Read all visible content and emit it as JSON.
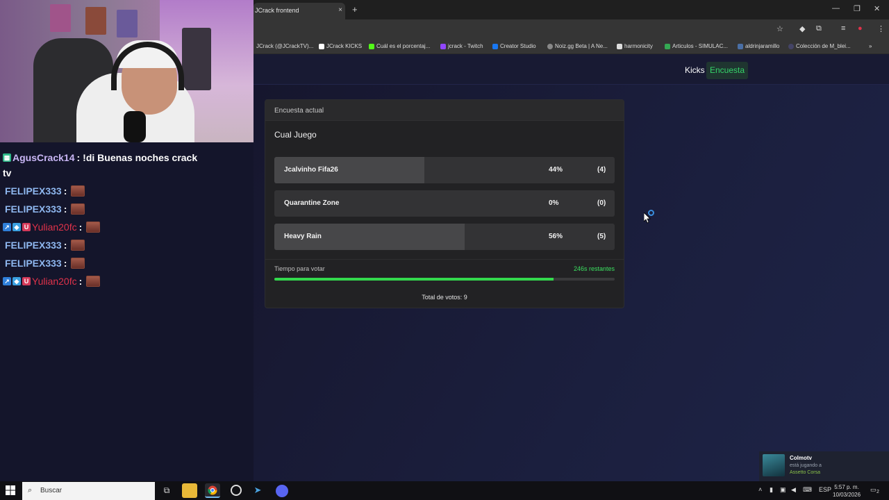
{
  "browser": {
    "tab_title": "JCrack frontend",
    "tab_close": "×",
    "new_tab": "+",
    "window_controls": {
      "minimize": "—",
      "restore": "❐",
      "close": "✕"
    },
    "bookmarks": [
      {
        "label": "JCrack (@JCrackTV)...",
        "color": "#333333"
      },
      {
        "label": "JCrack KICKS",
        "color": "#ffffff"
      },
      {
        "label": "Cuál es el porcentaj...",
        "color": "#53fc18"
      },
      {
        "label": "jcrack - Twitch",
        "color": "#9146ff"
      },
      {
        "label": "Creator Studio",
        "color": "#1877f2"
      },
      {
        "label": "Noiz.gg Beta | A Ne...",
        "color": "#888888"
      },
      {
        "label": "harmonicity",
        "color": "#dddddd"
      },
      {
        "label": "Articulos - SIMULAC...",
        "color": "#34a853"
      },
      {
        "label": "aldrinjaramillo",
        "color": "#4a6fa5"
      },
      {
        "label": "Colección de M_blei...",
        "color": "#444466"
      }
    ],
    "bookmarks_more": "»"
  },
  "app": {
    "nav": {
      "kicks": "Kicks",
      "encuesta": "Encuesta"
    },
    "poll": {
      "header": "Encuesta actual",
      "title": "Cual Juego",
      "options": [
        {
          "name": "Jcalvinho Fifa26",
          "percent_label": "44%",
          "count_label": "(4)",
          "share": 0.44
        },
        {
          "name": "Quarantine Zone",
          "percent_label": "0%",
          "count_label": "(0)",
          "share": 0.0
        },
        {
          "name": "Heavy Rain",
          "percent_label": "56%",
          "count_label": "(5)",
          "share": 0.56
        }
      ],
      "timer_label": "Tiempo para votar",
      "timer_remaining": "246s restantes",
      "timer_fraction": 0.82,
      "total_votes": "Total de votos: 9"
    }
  },
  "chat": {
    "messages": [
      {
        "user": "AgusCrack14",
        "text": "!di Buenas noches crack",
        "style": "purple"
      },
      {
        "continuation": "tv"
      },
      {
        "user": "FELIPEX333",
        "style": "blue"
      },
      {
        "user": "FELIPEX333",
        "style": "blue"
      },
      {
        "user": "Yulian20fc",
        "style": "red"
      },
      {
        "user": "FELIPEX333",
        "style": "blue"
      },
      {
        "user": "FELIPEX333",
        "style": "blue"
      },
      {
        "user": "Yulian20fc",
        "style": "red"
      }
    ],
    "separator": ":"
  },
  "toast": {
    "name": "Colmotv",
    "status": "está jugando a",
    "game": "Assetto Corsa"
  },
  "taskbar": {
    "search_placeholder": "Buscar",
    "language": "ESP",
    "time": "5:57 p. m.",
    "date": "10/03/2026",
    "notifications": "2"
  }
}
